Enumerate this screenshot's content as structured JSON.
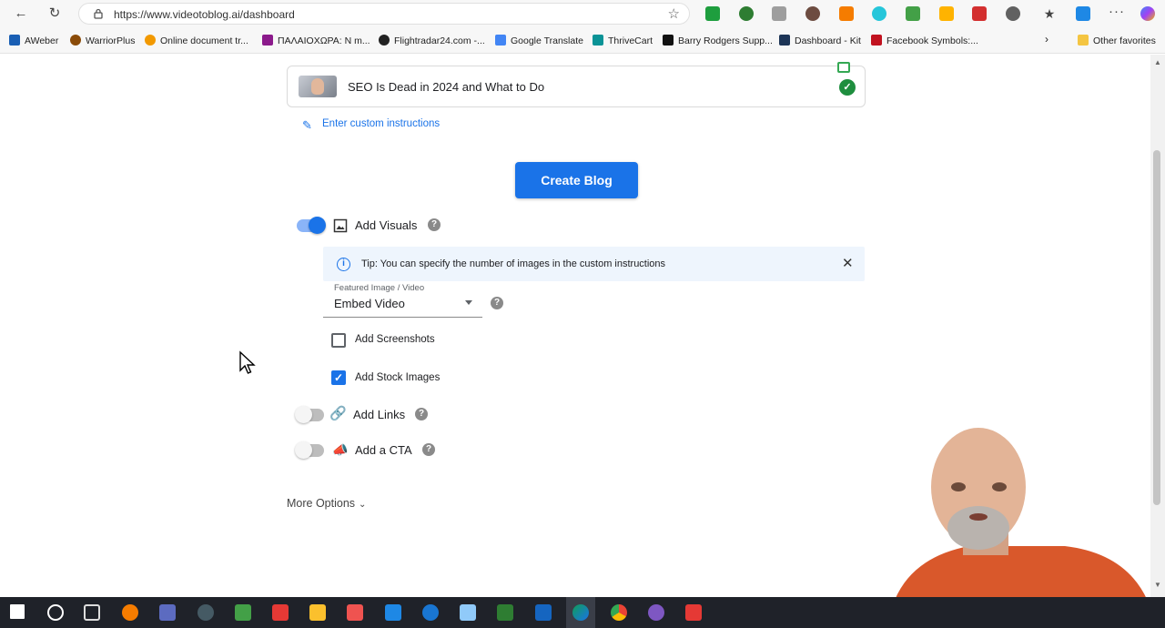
{
  "browser": {
    "url": "https://www.videotoblog.ai/dashboard",
    "bookmarks": [
      {
        "label": "AWeber",
        "color": "#1a5fb4"
      },
      {
        "label": "WarriorPlus",
        "color": "#8a4b08"
      },
      {
        "label": "Online document tr...",
        "color": "#f29900"
      },
      {
        "label": "ΠΑΛΑΙΟΧΩΡΑ: Ν m...",
        "color": "#8b1a8b"
      },
      {
        "label": "Flightradar24.com -...",
        "color": "#222222"
      },
      {
        "label": "Google Translate",
        "color": "#4285f4"
      },
      {
        "label": "ThriveCart",
        "color": "#0a9396"
      },
      {
        "label": "Barry Rodgers Supp...",
        "color": "#111111"
      },
      {
        "label": "Dashboard - Kit",
        "color": "#1d3557"
      },
      {
        "label": "Facebook Symbols:...",
        "color": "#c1121f"
      }
    ],
    "other_favorites": "Other favorites"
  },
  "video": {
    "title": "SEO Is Dead in 2024 and What to Do"
  },
  "custom_instructions_link": "Enter custom instructions",
  "create_button": "Create Blog",
  "options": {
    "add_visuals": {
      "label": "Add Visuals",
      "enabled": true
    },
    "tip": "Tip: You can specify the number of images in the custom instructions",
    "featured": {
      "label": "Featured Image / Video",
      "value": "Embed Video"
    },
    "add_screenshots": {
      "label": "Add Screenshots",
      "checked": false
    },
    "add_stock_images": {
      "label": "Add Stock Images",
      "checked": true
    },
    "add_links": {
      "label": "Add Links",
      "enabled": false
    },
    "add_cta": {
      "label": "Add a CTA",
      "enabled": false
    }
  },
  "more_options": "More Options",
  "colors": {
    "accent": "#1a73e8",
    "success": "#1e8e3e",
    "tip_background": "#eef5fd"
  }
}
